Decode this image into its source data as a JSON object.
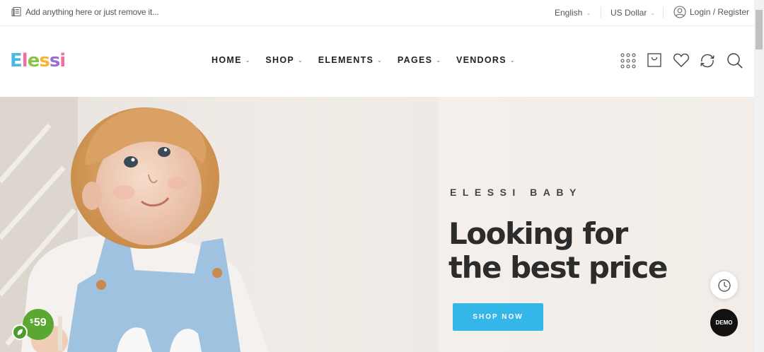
{
  "topbar": {
    "notice": "Add anything here or just remove it...",
    "language": "English",
    "currency": "US Dollar",
    "login": "Login / Register"
  },
  "header": {
    "logo_letters": [
      "E",
      "l",
      "e",
      "s",
      "s",
      "i"
    ],
    "logo_colors": [
      "#4cb8e6",
      "#f06ea0",
      "#8bc34a",
      "#f2b632",
      "#9b6fd1",
      "#f06ea0"
    ],
    "nav": [
      {
        "label": "HOME"
      },
      {
        "label": "SHOP"
      },
      {
        "label": "ELEMENTS"
      },
      {
        "label": "PAGES"
      },
      {
        "label": "VENDORS"
      }
    ],
    "icons": [
      "apps-grid-icon",
      "shopping-bag-icon",
      "heart-icon",
      "compare-icon",
      "search-icon"
    ]
  },
  "hero": {
    "eyebrow": "ELESSI BABY",
    "headline_line1": "Looking for",
    "headline_line2": "the best price",
    "cta_label": "SHOP NOW",
    "accent_color": "#35b6e8"
  },
  "floating": {
    "demo_label": "DEMO",
    "price_currency": "$",
    "price_amount": "59",
    "price_badge_color": "#5aa832"
  }
}
